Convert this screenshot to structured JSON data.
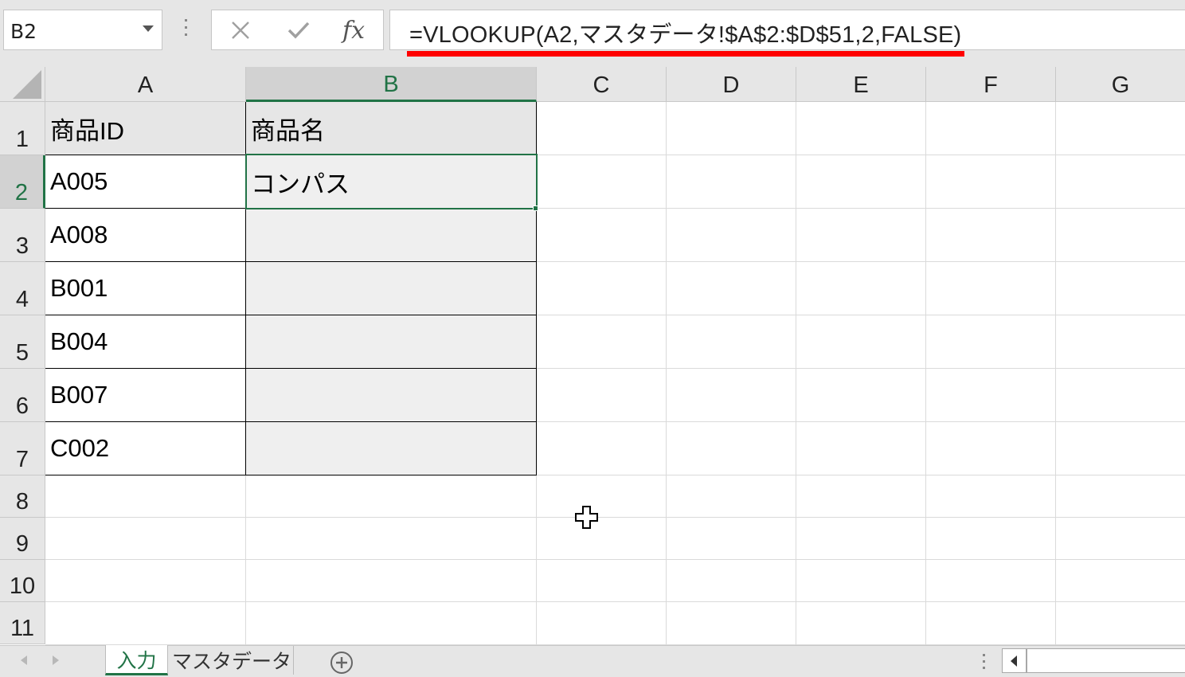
{
  "formula_bar": {
    "name_box": "B2",
    "fx_label": "fx",
    "formula": "=VLOOKUP(A2,マスタデータ!$A$2:$D$51,2,FALSE)"
  },
  "columns": [
    "A",
    "B",
    "C",
    "D",
    "E",
    "F",
    "G"
  ],
  "rows": [
    "1",
    "2",
    "3",
    "4",
    "5",
    "6",
    "7",
    "8",
    "9",
    "10",
    "11"
  ],
  "cells": {
    "A1": "商品ID",
    "B1": "商品名",
    "A2": "A005",
    "B2": "コンパス",
    "A3": "A008",
    "A4": "B001",
    "A5": "B004",
    "A6": "B007",
    "A7": "C002"
  },
  "selection": "B2",
  "sheet_tabs": [
    {
      "label": "入力",
      "active": true
    },
    {
      "label": "マスタデータ",
      "active": false
    }
  ],
  "colors": {
    "accent": "#217346",
    "annotation": "#ff0000",
    "table_shade": "#efefef"
  },
  "icons": [
    "cancel-icon",
    "enter-check-icon",
    "plus-cursor-icon",
    "add-sheet-icon",
    "dropdown-arrow-icon"
  ]
}
